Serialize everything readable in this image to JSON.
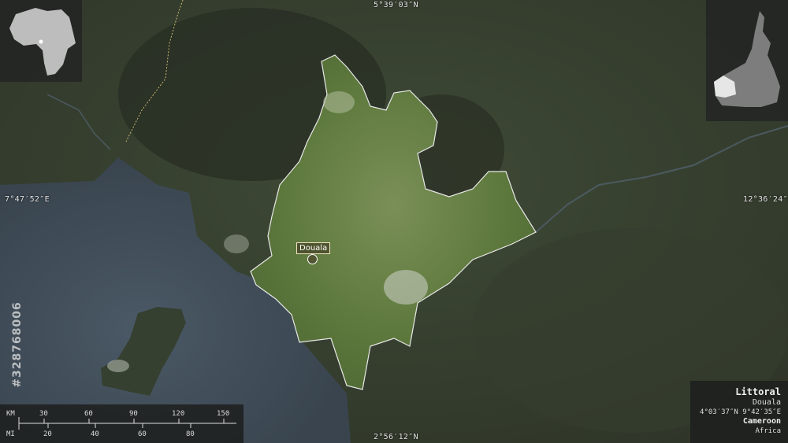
{
  "coordinates": {
    "north": "5°39′03″N",
    "south": "2°56′12″N",
    "west": "7°47′52″E",
    "east": "12°36′24″E"
  },
  "region": {
    "name": "Littoral",
    "capital": "Douala",
    "capital_coords": "4°03′37″N 9°42′35″E",
    "country": "Cameroon",
    "continent": "Africa"
  },
  "city_label": "Douala",
  "scale_bar": {
    "km_label": "KM",
    "mi_label": "MI",
    "km_ticks": [
      "30",
      "60",
      "90",
      "120",
      "150"
    ],
    "mi_ticks": [
      "20",
      "40",
      "60",
      "80"
    ]
  },
  "watermark": "#328768006",
  "colors": {
    "region_fill": "#5f7d3e",
    "ocean": "#3e4a55",
    "land": "#3a4232",
    "border": "#e8e8e8"
  }
}
